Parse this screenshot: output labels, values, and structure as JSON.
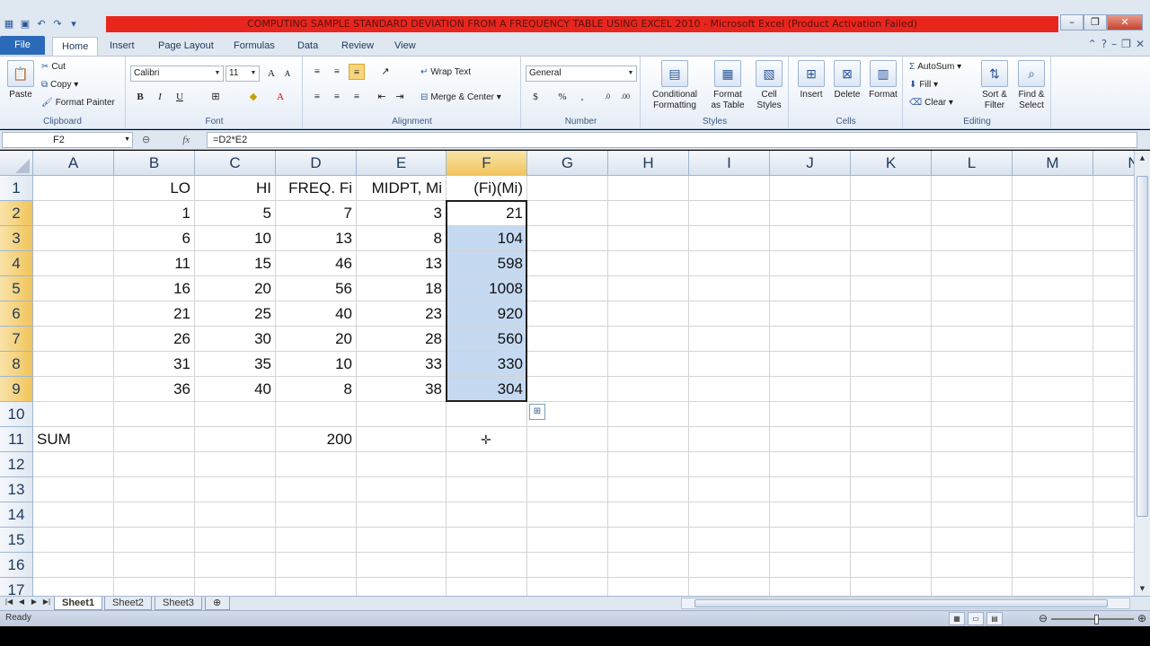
{
  "window": {
    "title": "COMPUTING SAMPLE STANDARD DEVIATION FROM A FREQUENCY TABLE USING EXCEL 2010  -  Microsoft Excel (Product Activation Failed)",
    "accent_color": "#e8261d"
  },
  "tabs": [
    "File",
    "Home",
    "Insert",
    "Page Layout",
    "Formulas",
    "Data",
    "Review",
    "View"
  ],
  "ribbon": {
    "clipboard": {
      "label": "Clipboard",
      "paste": "Paste",
      "cut": "Cut",
      "copy": "Copy",
      "format_painter": "Format Painter"
    },
    "font": {
      "label": "Font",
      "font_name": "Calibri",
      "font_size": "11"
    },
    "alignment": {
      "label": "Alignment",
      "wrap_text": "Wrap Text",
      "merge_center": "Merge & Center"
    },
    "number": {
      "label": "Number",
      "format": "General"
    },
    "styles": {
      "label": "Styles",
      "conditional": "Conditional\nFormatting",
      "format_table": "Format\nas Table",
      "cell_styles": "Cell\nStyles"
    },
    "cells": {
      "label": "Cells",
      "insert": "Insert",
      "delete": "Delete",
      "format": "Format"
    },
    "editing": {
      "label": "Editing",
      "autosum": "AutoSum",
      "fill": "Fill",
      "clear": "Clear",
      "sort_filter": "Sort &\nFilter",
      "find_select": "Find &\nSelect"
    }
  },
  "formula_bar": {
    "name_box": "F2",
    "fx": "fx",
    "formula": "=D2*E2"
  },
  "grid": {
    "columns": [
      "A",
      "B",
      "C",
      "D",
      "E",
      "F",
      "G",
      "H",
      "I",
      "J",
      "K",
      "L",
      "M",
      "N"
    ],
    "row_numbers": [
      "1",
      "2",
      "3",
      "4",
      "5",
      "6",
      "7",
      "8",
      "9",
      "10",
      "11",
      "12",
      "13",
      "14",
      "15",
      "16",
      "17"
    ],
    "rows": [
      [
        "",
        "LO",
        "HI",
        "FREQ. Fi",
        "MIDPT, Mi",
        "(Fi)(Mi)"
      ],
      [
        "",
        "1",
        "5",
        "7",
        "3",
        "21"
      ],
      [
        "",
        "6",
        "10",
        "13",
        "8",
        "104"
      ],
      [
        "",
        "11",
        "15",
        "46",
        "13",
        "598"
      ],
      [
        "",
        "16",
        "20",
        "56",
        "18",
        "1008"
      ],
      [
        "",
        "21",
        "25",
        "40",
        "23",
        "920"
      ],
      [
        "",
        "26",
        "30",
        "20",
        "28",
        "560"
      ],
      [
        "",
        "31",
        "35",
        "10",
        "33",
        "330"
      ],
      [
        "",
        "36",
        "40",
        "8",
        "38",
        "304"
      ],
      [
        "",
        "",
        "",
        "",
        "",
        ""
      ],
      [
        "SUM",
        "",
        "",
        "200",
        "",
        ""
      ]
    ],
    "selected_cell": "F2",
    "selection_fill": "#c5d9f1"
  },
  "sheets": [
    "Sheet1",
    "Sheet2",
    "Sheet3"
  ],
  "active_sheet": "Sheet1",
  "status": {
    "ready": "Ready"
  }
}
